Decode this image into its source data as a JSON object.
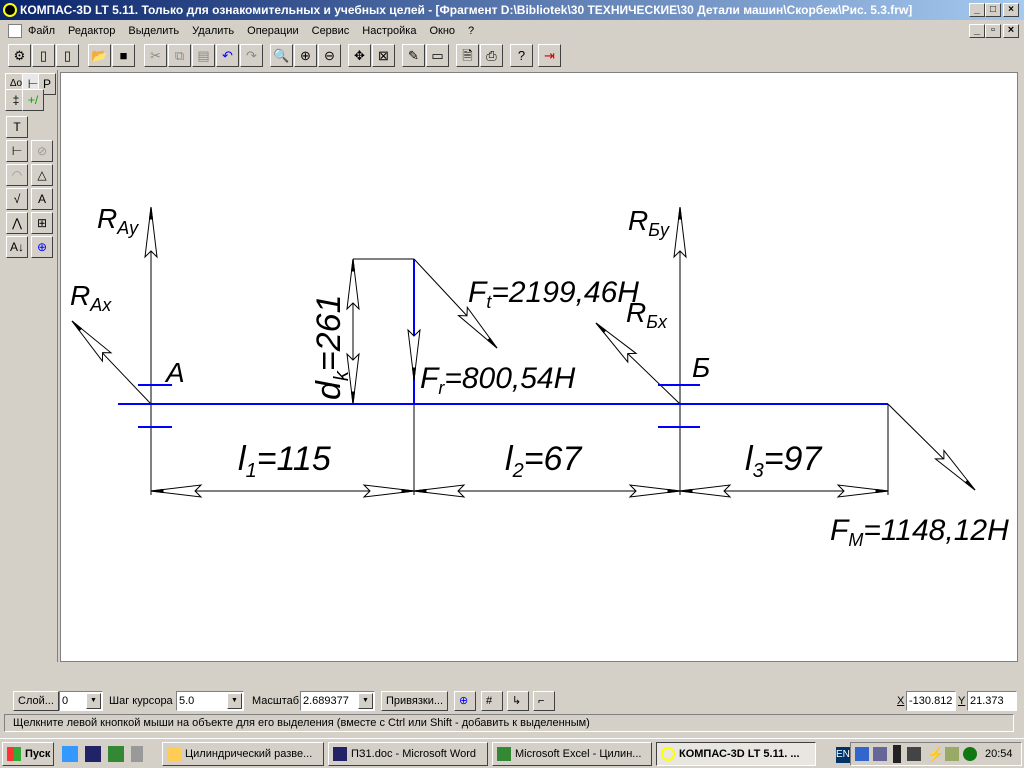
{
  "window": {
    "title": "КОМПАС-3D LT 5.11. Только для ознакомительных и учебных целей - [Фрагмент D:\\Bibliotek\\30 ТЕХНИЧЕСКИЕ\\30 Детали машин\\Скорбеж\\Рис. 5.3.frw]",
    "minimize": "_",
    "maximize": "□",
    "close": "×"
  },
  "menu": [
    "Файл",
    "Редактор",
    "Выделить",
    "Удалить",
    "Операции",
    "Сервис",
    "Настройка",
    "Окно",
    "?"
  ],
  "toolbar": [
    "new-document",
    "new-sheet",
    "new-fragment",
    "open",
    "save",
    "cut",
    "copy",
    "paste",
    "undo",
    "redo",
    "zoom-window",
    "zoom-in",
    "zoom-out",
    "pan",
    "show-all",
    "redraw",
    "layers",
    "preview",
    "help-print",
    "context-help",
    "exit"
  ],
  "drawing": {
    "RAy": {
      "main": "R",
      "sub": "Ay"
    },
    "RAx": {
      "main": "R",
      "sub": "Ax"
    },
    "A": "A",
    "B": "Б",
    "RBy": {
      "main": "R",
      "sub": "Бy"
    },
    "RBx": {
      "main": "R",
      "sub": "Бx"
    },
    "dk": {
      "main": "d",
      "sub": "k",
      "rest": "=261"
    },
    "Ft": {
      "main": "F",
      "sub": "t",
      "rest": "=2199,46H"
    },
    "Fr": {
      "main": "F",
      "sub": "r",
      "rest": "=800,54H"
    },
    "Fm": {
      "main": "F",
      "sub": "M",
      "rest": "=1148,12H"
    },
    "l1": {
      "main": "l",
      "sub": "1",
      "rest": "=115"
    },
    "l2": {
      "main": "l",
      "sub": "2",
      "rest": "=67"
    },
    "l3": {
      "main": "l",
      "sub": "3",
      "rest": "=97"
    },
    "colors": {
      "shaft": "#0000ff",
      "lines": "#000000"
    }
  },
  "bottombar": {
    "layer_button": "Слой...",
    "layer_value": "0",
    "step_label": "Шаг курсора",
    "step_value": "5.0",
    "scale_label": "Масштаб",
    "scale_value": "2.689377",
    "snaps_button": "Привязки...",
    "x_label": "X",
    "x_value": "-130.812",
    "y_label": "Y",
    "y_value": "21.373"
  },
  "status": "Щелкните левой кнопкой мыши на объекте для его выделения (вместе с Ctrl или Shift - добавить к выделенным)",
  "taskbar": {
    "start": "Пуск",
    "tasks": [
      "Цилиндрический разве...",
      "ПЗ1.doc - Microsoft Word",
      "Microsoft Excel - Цилин...",
      "КОМПАС-3D LT 5.11. ..."
    ],
    "lang": "EN",
    "clock": "20:54"
  }
}
